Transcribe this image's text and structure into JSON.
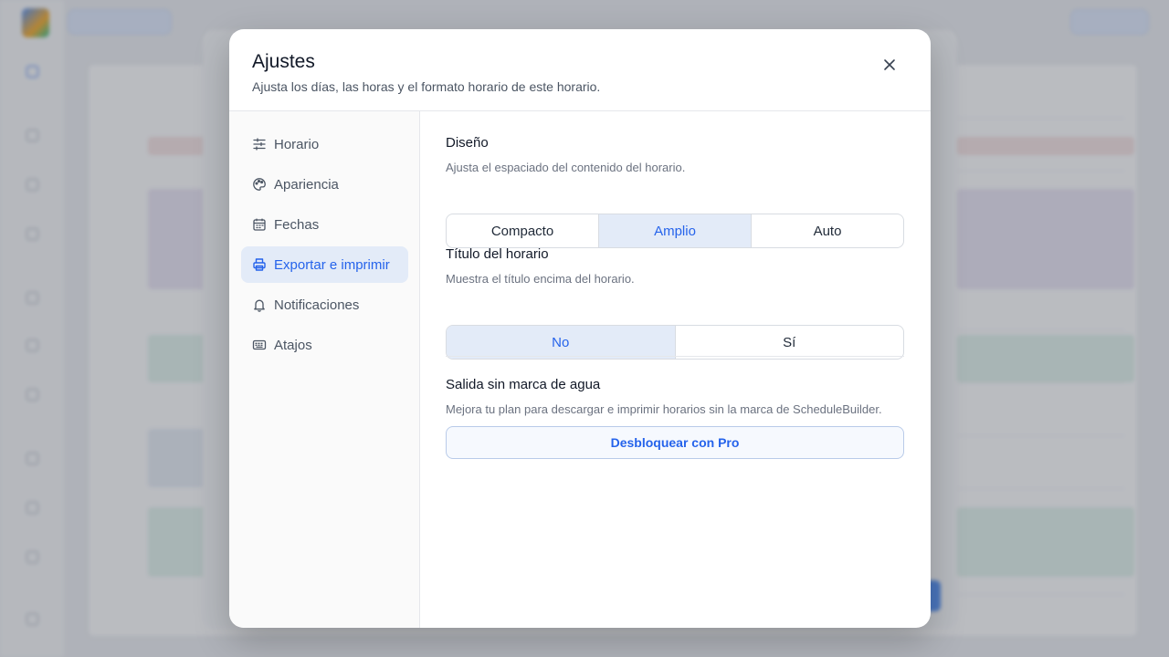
{
  "modal": {
    "title": "Ajustes",
    "subtitle": "Ajusta los días, las horas y el formato horario de este horario.",
    "close_icon": "close-icon"
  },
  "nav": {
    "items": [
      {
        "label": "Horario",
        "icon": "sliders-icon",
        "active": false
      },
      {
        "label": "Apariencia",
        "icon": "palette-icon",
        "active": false
      },
      {
        "label": "Fechas",
        "icon": "calendar-icon",
        "active": false
      },
      {
        "label": "Exportar e imprimir",
        "icon": "printer-icon",
        "active": true
      },
      {
        "label": "Notificaciones",
        "icon": "bell-icon",
        "active": false
      },
      {
        "label": "Atajos",
        "icon": "keyboard-icon",
        "active": false
      }
    ]
  },
  "design": {
    "title": "Diseño",
    "description": "Ajusta el espaciado del contenido del horario.",
    "options": [
      "Compacto",
      "Amplio",
      "Auto"
    ],
    "selected": "Amplio"
  },
  "schedule_title": {
    "title": "Título del horario",
    "description": "Muestra el título encima del horario.",
    "options": [
      "No",
      "Sí"
    ],
    "selected": "No"
  },
  "watermark": {
    "title": "Salida sin marca de agua",
    "description": "Mejora tu plan para descargar e imprimir horarios sin la marca de ScheduleBuilder.",
    "button_label": "Desbloquear con Pro"
  },
  "colors": {
    "accent": "#2563eb",
    "selected_bg": "#e3ebf8"
  }
}
